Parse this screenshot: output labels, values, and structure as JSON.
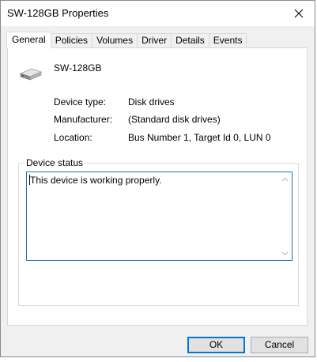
{
  "window": {
    "title": "SW-128GB Properties"
  },
  "tabs": [
    {
      "label": "General",
      "active": true
    },
    {
      "label": "Policies",
      "active": false
    },
    {
      "label": "Volumes",
      "active": false
    },
    {
      "label": "Driver",
      "active": false
    },
    {
      "label": "Details",
      "active": false
    },
    {
      "label": "Events",
      "active": false
    }
  ],
  "device": {
    "name": "SW-128GB",
    "icon": "disk-drive-icon"
  },
  "properties": [
    {
      "label": "Device type:",
      "value": "Disk drives"
    },
    {
      "label": "Manufacturer:",
      "value": "(Standard disk drives)"
    },
    {
      "label": "Location:",
      "value": "Bus Number 1, Target Id 0, LUN 0"
    }
  ],
  "status": {
    "group_label": "Device status",
    "text": "This device is working properly."
  },
  "buttons": {
    "ok": "OK",
    "cancel": "Cancel"
  },
  "colors": {
    "accent": "#0078d7",
    "status_border": "#2a6ea8"
  }
}
